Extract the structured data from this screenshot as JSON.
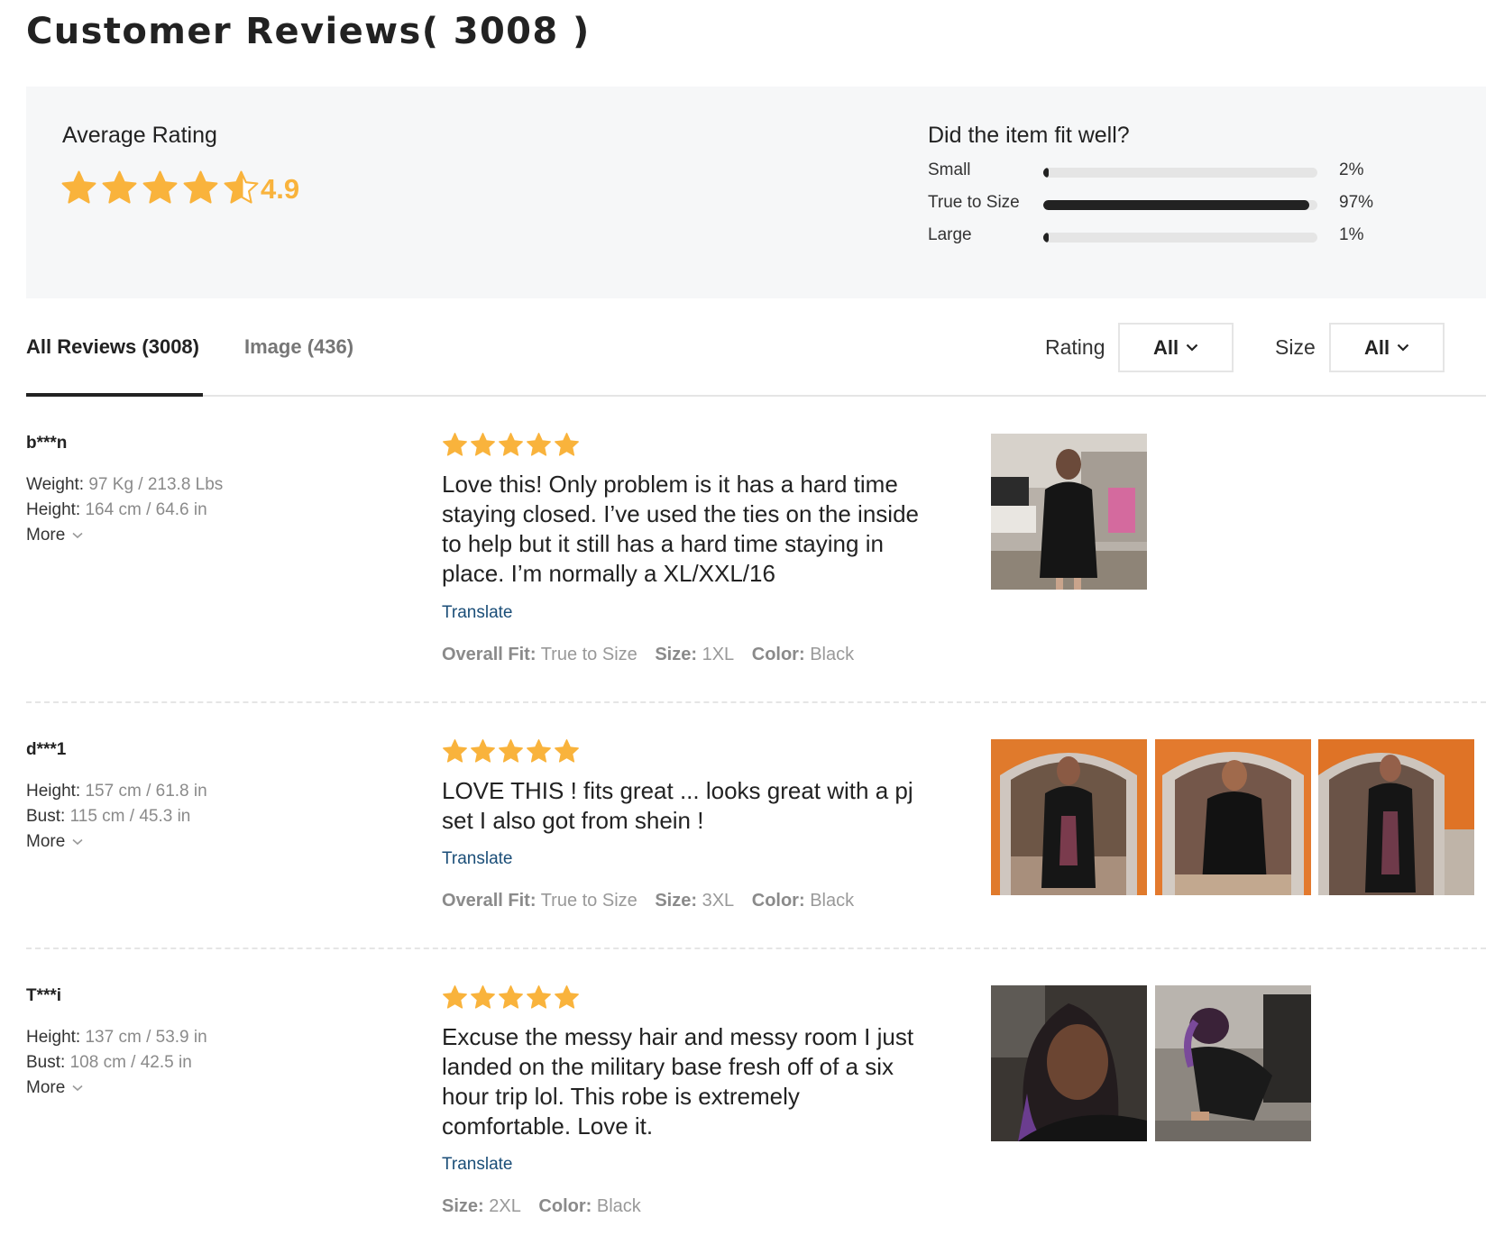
{
  "page": {
    "title": "Customer Reviews( 3008 )"
  },
  "summary": {
    "average_label": "Average Rating",
    "average_value": "4.9",
    "average_stars": 4.9,
    "fit_title": "Did the item fit well?",
    "fit": [
      {
        "label": "Small",
        "percent_text": "2%",
        "fraction": 0.02
      },
      {
        "label": "True to Size",
        "percent_text": "97%",
        "fraction": 0.97
      },
      {
        "label": "Large",
        "percent_text": "1%",
        "fraction": 0.01
      }
    ]
  },
  "tabs": [
    {
      "label": "All Reviews (3008)",
      "active": true
    },
    {
      "label": "Image (436)",
      "active": false
    }
  ],
  "filters": {
    "rating_label": "Rating",
    "rating_value": "All",
    "size_label": "Size",
    "size_value": "All"
  },
  "colors": {
    "star": "#f9b33c",
    "translate_link": "#1b4e78",
    "bar_fill": "#222222",
    "bar_track": "#e5e5e5",
    "summary_bg": "#f6f7f8"
  },
  "reviews": [
    {
      "user": "b***n",
      "attrs": [
        {
          "key": "Weight:",
          "value": "97 Kg / 213.8 Lbs"
        },
        {
          "key": "Height:",
          "value": "164 cm / 64.6 in"
        }
      ],
      "more_label": "More",
      "stars": 5,
      "text": "Love this! Only problem is it has a hard time staying closed. I’ve used the ties on the inside to help but it still has a hard time staying in place. I’m normally a XL/XXL/16",
      "translate_label": "Translate",
      "meta": [
        {
          "key": "Overall Fit:",
          "value": "True to Size"
        },
        {
          "key": "Size:",
          "value": "1XL"
        },
        {
          "key": "Color:",
          "value": "Black"
        }
      ],
      "photo_count": 1
    },
    {
      "user": "d***1",
      "attrs": [
        {
          "key": "Height:",
          "value": "157 cm / 61.8 in"
        },
        {
          "key": "Bust:",
          "value": "115 cm / 45.3 in"
        }
      ],
      "more_label": "More",
      "stars": 5,
      "text": "LOVE THIS ! fits great ... looks great with a pj set I also got from shein !",
      "translate_label": "Translate",
      "meta": [
        {
          "key": "Overall Fit:",
          "value": "True to Size"
        },
        {
          "key": "Size:",
          "value": "3XL"
        },
        {
          "key": "Color:",
          "value": "Black"
        }
      ],
      "photo_count": 3
    },
    {
      "user": "T***i",
      "attrs": [
        {
          "key": "Height:",
          "value": "137 cm / 53.9 in"
        },
        {
          "key": "Bust:",
          "value": "108 cm / 42.5 in"
        }
      ],
      "more_label": "More",
      "stars": 5,
      "text": "Excuse the messy hair and messy room I just landed on the military base fresh off of a six hour trip lol. This robe is extremely comfortable. Love it.",
      "translate_label": "Translate",
      "meta": [
        {
          "key": "Size:",
          "value": "2XL"
        },
        {
          "key": "Color:",
          "value": "Black"
        }
      ],
      "photo_count": 2
    }
  ]
}
